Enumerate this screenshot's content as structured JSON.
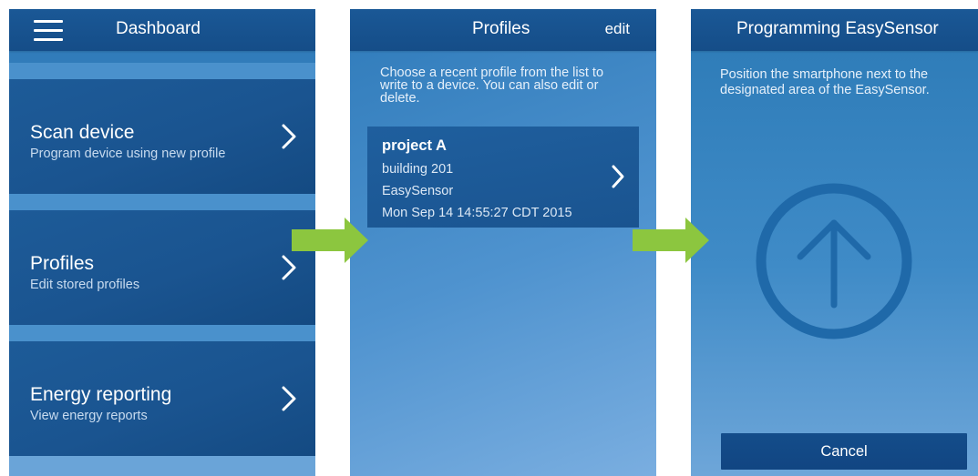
{
  "dashboard": {
    "title": "Dashboard",
    "items": [
      {
        "title": "Scan device",
        "subtitle": "Program device using new profile"
      },
      {
        "title": "Profiles",
        "subtitle": "Edit stored profiles"
      },
      {
        "title": "Energy reporting",
        "subtitle": "View energy reports"
      }
    ]
  },
  "profiles": {
    "title": "Profiles",
    "edit_label": "edit",
    "intro_lines": [
      "Choose a recent profile from the list to",
      "write to a device. You can also edit or",
      "delete."
    ],
    "card": {
      "name": "project A",
      "building": "building 201",
      "device": "EasySensor",
      "timestamp": "Mon Sep 14 14:55:27 CDT 2015"
    }
  },
  "programming": {
    "title": "Programming EasySensor",
    "instruction_lines": [
      "Position the smartphone next to the",
      "designated area of the EasySensor."
    ],
    "cancel_label": "Cancel"
  },
  "colors": {
    "arrow_green": "#8cc63f",
    "header_blue": "#1a5896",
    "tile_blue": "#1a5490"
  },
  "icons": {
    "menu": "hamburger-icon",
    "chevron": "chevron-right-icon",
    "upload": "circle-arrow-up-icon",
    "flow_arrow": "green-right-arrow"
  }
}
